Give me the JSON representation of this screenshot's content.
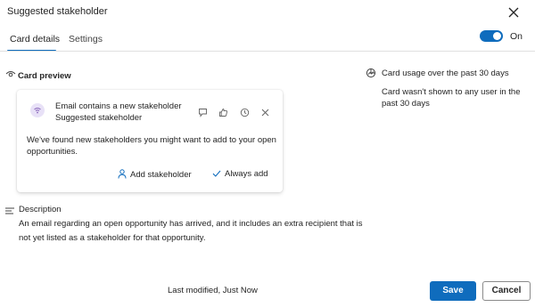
{
  "dialog": {
    "title": "Suggested stakeholder"
  },
  "tabs": [
    {
      "label": "Card details",
      "selected": true
    },
    {
      "label": "Settings",
      "selected": false
    }
  ],
  "toggle": {
    "state_label": "On",
    "enabled": true
  },
  "card_preview": {
    "heading": "Card preview",
    "card": {
      "title": "Email contains a new stakeholder",
      "subtitle": "Suggested stakeholder",
      "body": "We've found new stakeholders you might want to add to your open opportunities.",
      "actions": {
        "add_stakeholder": "Add stakeholder",
        "always_add": "Always add"
      },
      "icons": [
        "feedback-icon",
        "thumbs-up-icon",
        "snooze-icon",
        "dismiss-icon"
      ]
    }
  },
  "usage": {
    "heading": "Card usage over the past 30 days",
    "text": "Card wasn't shown to any user in the past 30 days"
  },
  "description": {
    "heading": "Description",
    "text": "An email regarding an open opportunity has arrived, and it includes an extra recipient that is not yet listed as a stakeholder for that opportunity."
  },
  "footer": {
    "last_modified": "Last modified, Just Now",
    "save_label": "Save",
    "cancel_label": "Cancel"
  },
  "colors": {
    "accent": "#0f6cbd",
    "avatar_bg": "#e8e1f7",
    "avatar_fg": "#8764b8"
  }
}
